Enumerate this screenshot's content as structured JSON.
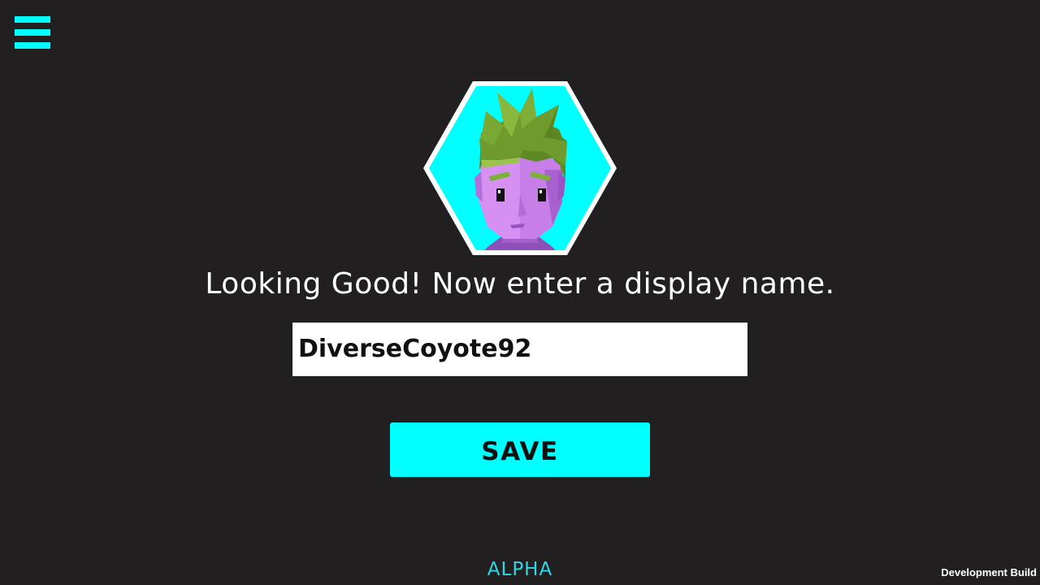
{
  "menu": {
    "icon": "hamburger-menu-icon"
  },
  "avatar": {
    "icon": "avatar-portrait-icon"
  },
  "prompt": {
    "text": "Looking Good!  Now enter a display name."
  },
  "name_input": {
    "value": "DiverseCoyote92"
  },
  "save_button": {
    "label": "SAVE"
  },
  "footer": {
    "alpha": "ALPHA",
    "dev_build": "Development Build"
  },
  "colors": {
    "background": "#221f20",
    "accent": "#00ffff",
    "alpha_text": "#2fd6e6",
    "avatar_skin": "#c77ee6",
    "avatar_hair": "#6e9a2e"
  }
}
